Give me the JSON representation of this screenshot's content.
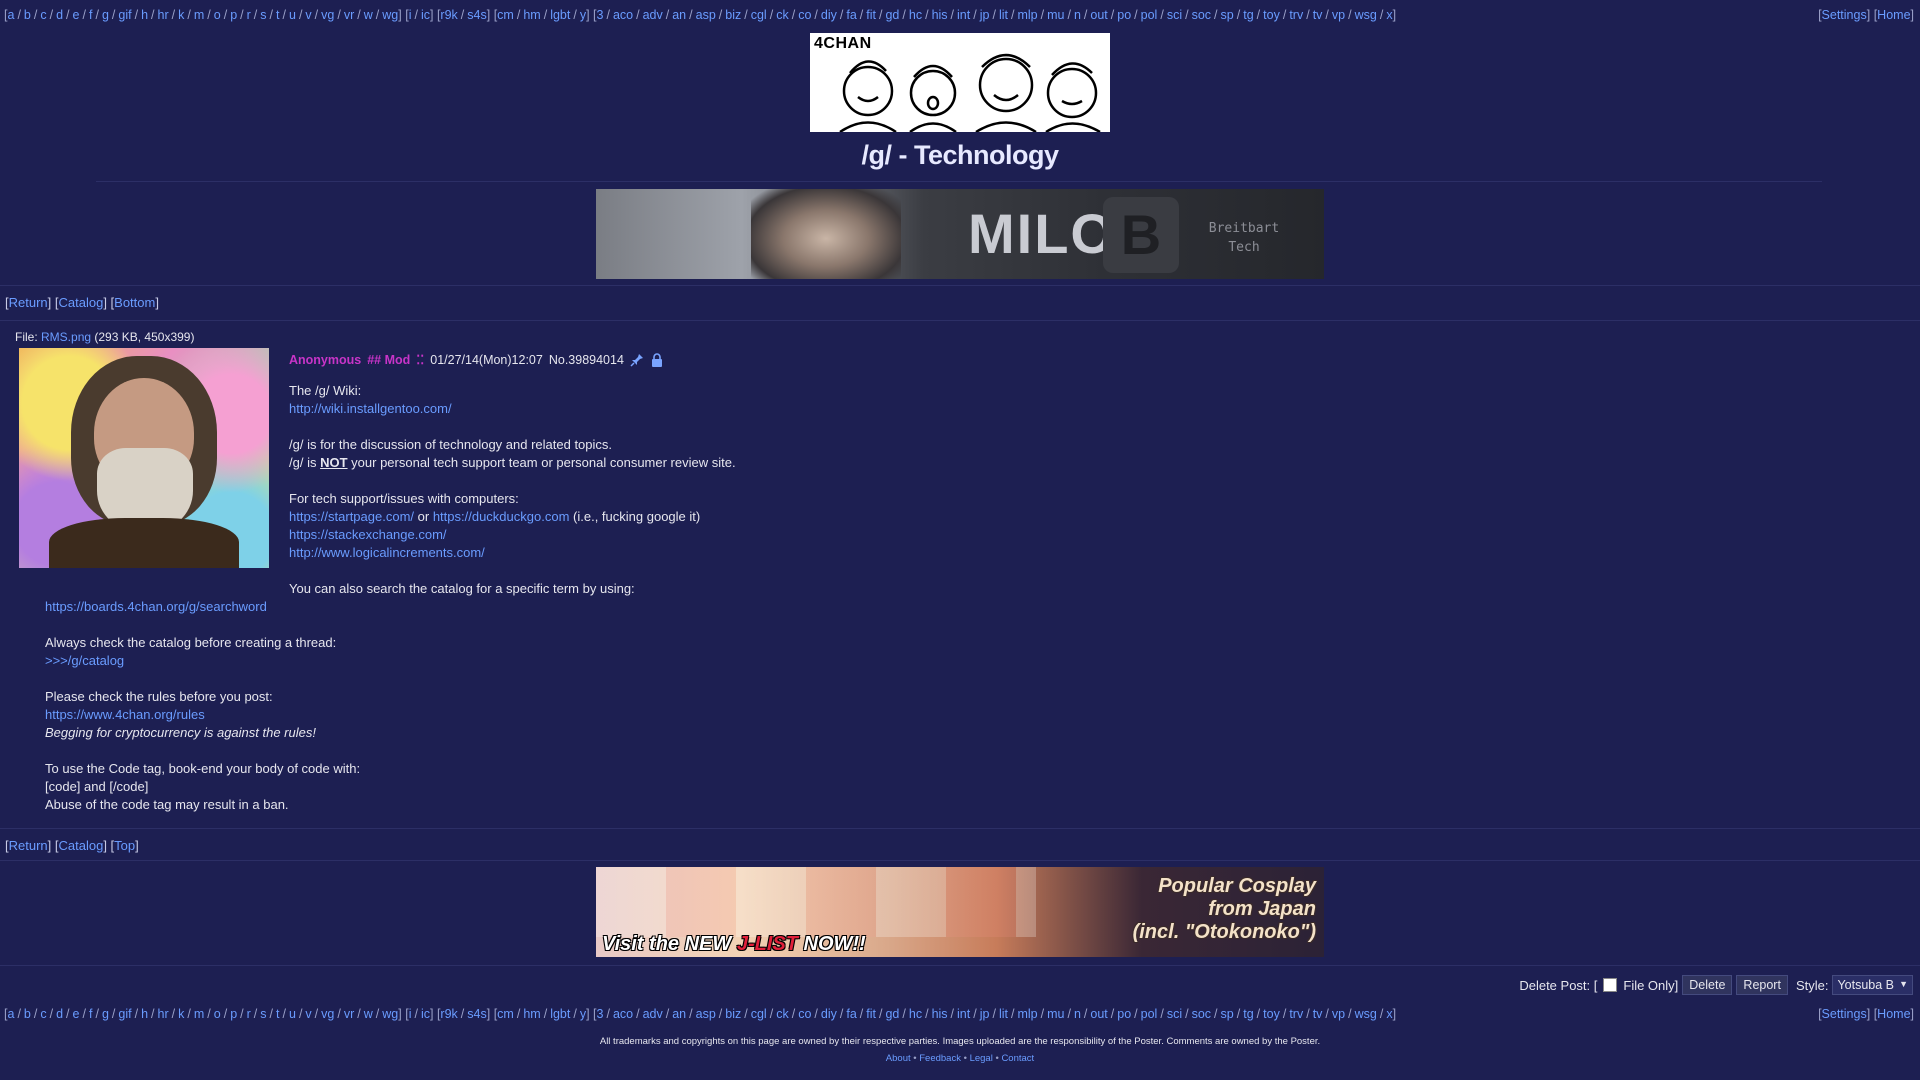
{
  "boards": [
    "a",
    "b",
    "c",
    "d",
    "e",
    "f",
    "g",
    "gif",
    "h",
    "hr",
    "k",
    "m",
    "o",
    "p",
    "r",
    "s",
    "t",
    "u",
    "v",
    "vg",
    "vr",
    "w",
    "wg",
    "i",
    "ic",
    "r9k",
    "s4s",
    "cm",
    "hm",
    "lgbt",
    "y",
    "3",
    "aco",
    "adv",
    "an",
    "asp",
    "biz",
    "cgl",
    "ck",
    "co",
    "diy",
    "fa",
    "fit",
    "gd",
    "hc",
    "his",
    "int",
    "jp",
    "lit",
    "mlp",
    "mu",
    "n",
    "out",
    "po",
    "pol",
    "sci",
    "soc",
    "sp",
    "tg",
    "toy",
    "trv",
    "tv",
    "vp",
    "wsg",
    "x"
  ],
  "nav_right": {
    "settings": "Settings",
    "home": "Home"
  },
  "banner": {
    "text": "4CHAN"
  },
  "board_title": "/g/ - Technology",
  "ad_top": {
    "name": "MILO",
    "logo": "B",
    "tag_line1": "Breitbart",
    "tag_line2": "Tech"
  },
  "nav_top": {
    "return": "Return",
    "catalog": "Catalog",
    "bottom": "Bottom"
  },
  "nav_bottom": {
    "return": "Return",
    "catalog": "Catalog",
    "top": "Top"
  },
  "file": {
    "label": "File:",
    "name": "RMS.png",
    "meta": "(293 KB, 450x399)"
  },
  "post": {
    "name": "Anonymous",
    "capcode": "## Mod",
    "dots": "⁚⁚",
    "date": "01/27/14(Mon)12:07",
    "no_label": "No.",
    "no": "39894014"
  },
  "message": {
    "wiki_title": "The /g/ Wiki:",
    "wiki_url": "http://wiki.installgentoo.com/",
    "discussion": "/g/ is for the discussion of technology and related topics.",
    "not_prefix": "/g/ is",
    "not_word": "NOT",
    "not_suffix": "your personal tech support team or personal consumer review site.",
    "support_title": "For tech support/issues with computers:",
    "startpage": "https://startpage.com/",
    "or_word": "or",
    "ddg": "https://duckduckgo.com",
    "ie": "(i.e., fucking google it)",
    "stackexchange": "https://stackexchange.com/",
    "logical": "http://www.logicalincrements.com/",
    "search_text": "You can also search the catalog for a specific term by using:",
    "search_url": "https://boards.4chan.org/g/searchword",
    "catalog_text": "Always check the catalog before creating a thread:",
    "catalog_link": ">>>/g/catalog",
    "rules_text": "Please check the rules before you post:",
    "rules_url": "https://www.4chan.org/rules",
    "crypto": "Begging for cryptocurrency is against the rules!",
    "code_text": "To use the Code tag, book-end your body of code with:",
    "code_tags": "[code] and [/code]",
    "abuse": "Abuse of the code tag may result in a ban."
  },
  "ad_bottom": {
    "visit_prefix": "Visit the NEW ",
    "visit_brand": "J-LIST",
    "visit_suffix": " NOW!!",
    "line1": "Popular Cosplay",
    "line2": "from Japan",
    "line3": "(incl. \"Otokonoko\")"
  },
  "controls": {
    "delete_post": "Delete Post: [",
    "file_only": "File Only]",
    "delete_btn": "Delete",
    "report_btn": "Report",
    "style_label": "Style:",
    "style_value": "Yotsuba B"
  },
  "legal": {
    "text": "All trademarks and copyrights on this page are owned by their respective parties. Images uploaded are the responsibility of the Poster. Comments are owned by the Poster.",
    "about": "About",
    "feedback": "Feedback",
    "legal": "Legal",
    "contact": "Contact"
  }
}
